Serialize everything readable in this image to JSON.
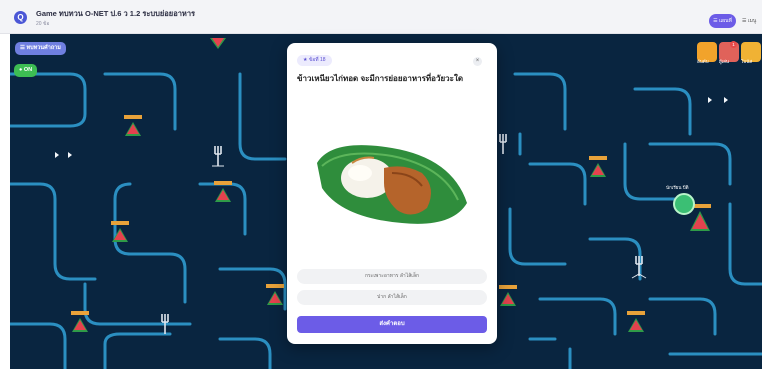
{
  "header": {
    "logo_glyph": "Q",
    "title": "Game ทบทวน O-NET ป.6 ว 1.2 ระบบย่อยอาหาร",
    "subtitle": "20 ข้อ",
    "menu_label": "☰ แผนที่",
    "more_label": "☰ เมนู"
  },
  "game": {
    "left_chip": "☰ ทบทวนคำถาม",
    "on_chip": "● ON",
    "hud": [
      {
        "label": "อันดับ",
        "icon": "trophy-icon"
      },
      {
        "label": "ผู้เล่น",
        "icon": "players-icon"
      },
      {
        "label": "โบนัส",
        "icon": "bonus-icon"
      }
    ],
    "hud_badge": "1",
    "player_name": "นักเรียน ปีติ"
  },
  "modal": {
    "badge": "★ ข้อที่ 18",
    "question": "ข้าวเหนียวไก่ทอด จะมีการย่อยอาหารที่อวัยวะใด",
    "image_alt": "ข้าวเหนียวไก่ทอด",
    "options": [
      "กระเพาะอาหาร ลำไส้เล็ก",
      "ปาก ลำไส้เล็ก"
    ],
    "submit_label": "ส่งคำตอบ"
  },
  "colors": {
    "accent": "#6c5ce7",
    "maze_wall": "#2f9bd0",
    "maze_bg": "#092540",
    "on_chip": "#3dbd53"
  }
}
